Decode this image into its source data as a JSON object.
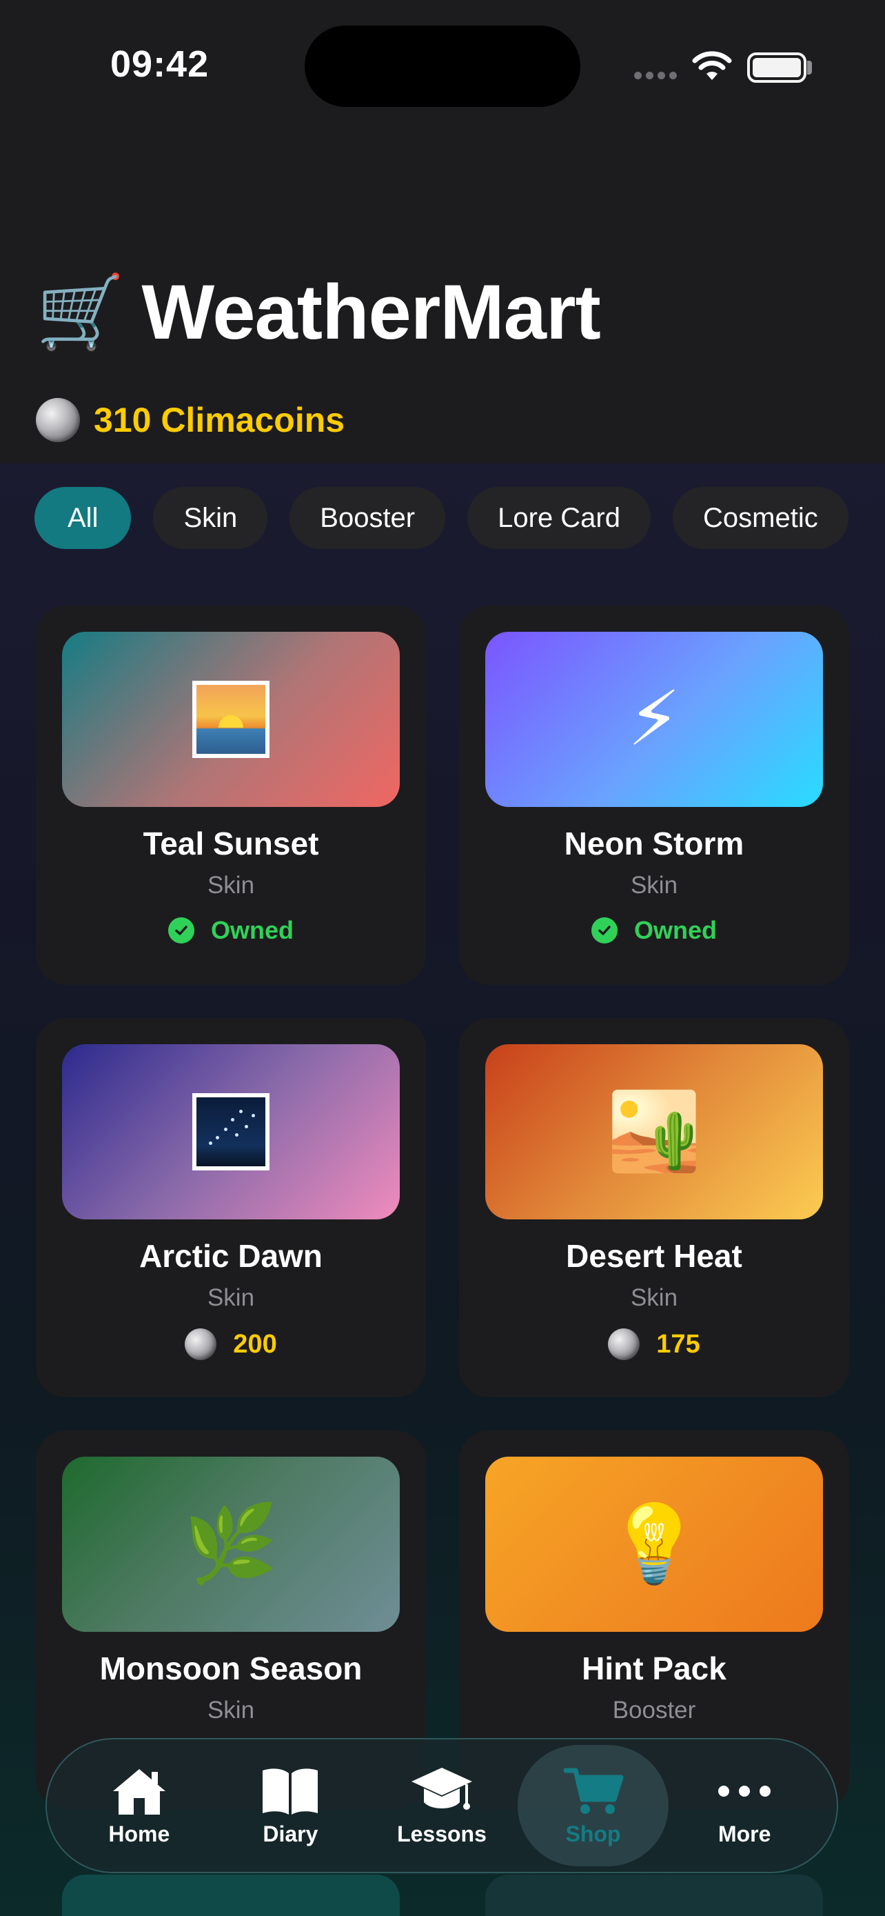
{
  "status_bar": {
    "time": "09:42"
  },
  "header": {
    "cart_emoji": "🛒",
    "title": "WeatherMart"
  },
  "balance": {
    "text": "310 Climacoins",
    "amount": 310
  },
  "filters": [
    {
      "label": "All",
      "active": true
    },
    {
      "label": "Skin",
      "active": false
    },
    {
      "label": "Booster",
      "active": false
    },
    {
      "label": "Lore Card",
      "active": false
    },
    {
      "label": "Cosmetic",
      "active": false
    }
  ],
  "items": [
    {
      "name": "Teal Sunset",
      "type": "Skin",
      "status": "Owned",
      "icon": "sunset-picture-icon"
    },
    {
      "name": "Neon Storm",
      "type": "Skin",
      "status": "Owned",
      "icon": "⚡"
    },
    {
      "name": "Arctic Dawn",
      "type": "Skin",
      "price": "200",
      "icon": "night-sky-picture-icon"
    },
    {
      "name": "Desert Heat",
      "type": "Skin",
      "price": "175",
      "icon": "🏜️"
    },
    {
      "name": "Monsoon Season",
      "type": "Skin",
      "icon": "🌿"
    },
    {
      "name": "Hint Pack",
      "type": "Booster",
      "icon": "💡"
    }
  ],
  "tabs": [
    {
      "label": "Home",
      "icon": "house-icon",
      "active": false
    },
    {
      "label": "Diary",
      "icon": "book-icon",
      "active": false
    },
    {
      "label": "Lessons",
      "icon": "graduation-cap-icon",
      "active": false
    },
    {
      "label": "Shop",
      "icon": "cart-icon",
      "active": true
    },
    {
      "label": "More",
      "icon": "ellipsis-icon",
      "active": false
    }
  ],
  "colors": {
    "accent": "#127a80",
    "coin_text": "#ffcc00",
    "owned": "#30d158",
    "background": "#1c1c1e"
  }
}
